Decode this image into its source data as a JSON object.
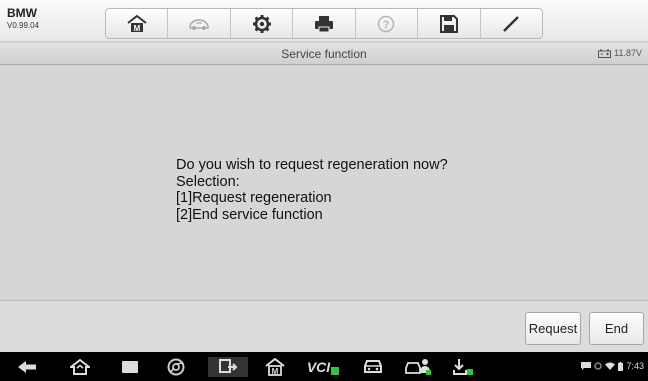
{
  "vehicle": {
    "make": "BMW",
    "version": "V0.99.04"
  },
  "toolbar": {
    "icons": [
      "home-icon",
      "vehicle-swap-icon",
      "settings-icon",
      "print-icon",
      "help-icon",
      "save-icon",
      "edit-icon"
    ]
  },
  "header": {
    "title": "Service function",
    "voltage": "11.87V"
  },
  "dialog": {
    "lines": [
      "Do you wish to request regeneration now?",
      "Selection:",
      "[1]Request regeneration",
      "[2]End service function"
    ]
  },
  "actions": {
    "request_label": "Request",
    "end_label": "End"
  },
  "navbar": {
    "vcl_label": "VCI",
    "time": "7:43"
  },
  "colors": {
    "background": "#d6d6d6",
    "navbar": "#000000",
    "accent_green": "#35c142"
  }
}
